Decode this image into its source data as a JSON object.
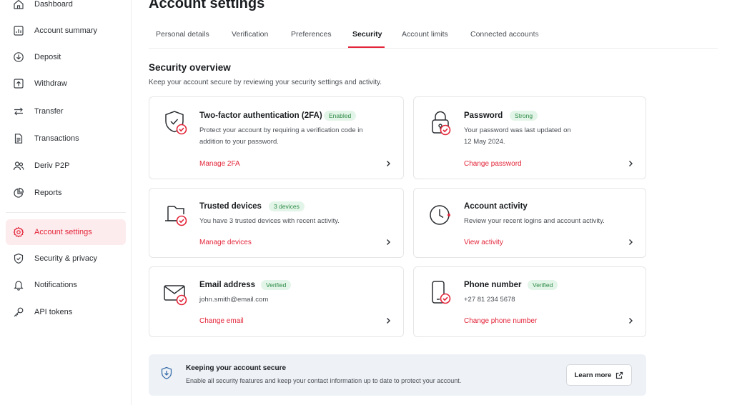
{
  "sidebar": {
    "items": [
      {
        "label": "Dashboard",
        "icon": "home-icon"
      },
      {
        "label": "Account summary",
        "icon": "chart-icon"
      },
      {
        "label": "Deposit",
        "icon": "deposit-icon"
      },
      {
        "label": "Withdraw",
        "icon": "withdraw-icon"
      },
      {
        "label": "Transfer",
        "icon": "transfer-icon"
      },
      {
        "label": "Transactions",
        "icon": "document-icon"
      },
      {
        "label": "Deriv P2P",
        "icon": "users-icon"
      },
      {
        "label": "Reports",
        "icon": "pie-chart-icon"
      },
      {
        "label": "Account settings",
        "icon": "gear-icon",
        "active": true
      },
      {
        "label": "Security & privacy",
        "icon": "shield-icon"
      },
      {
        "label": "Notifications",
        "icon": "bell-icon"
      },
      {
        "label": "API tokens",
        "icon": "key-icon"
      }
    ]
  },
  "header": {
    "title": "Account settings",
    "tabs": [
      {
        "label": "Personal details"
      },
      {
        "label": "Verification"
      },
      {
        "label": "Preferences"
      },
      {
        "label": "Security",
        "active": true
      },
      {
        "label": "Account limits"
      },
      {
        "label": "Connected accounts"
      }
    ]
  },
  "section": {
    "title": "Security overview",
    "subtitle": "Keep your account secure by reviewing your security settings and activity."
  },
  "cards": {
    "twofa": {
      "title": "Two-factor authentication (2FA)",
      "badge": "Enabled",
      "desc": "Protect your account by requiring a verification code in addition to your password.",
      "link": "Manage 2FA",
      "icon": "shield-check-icon"
    },
    "password": {
      "title": "Password",
      "badge": "Strong",
      "desc_line1": "Your password was last updated on",
      "desc_line2": "12 May 2024.",
      "link": "Change password",
      "icon": "padlock-icon"
    },
    "devices": {
      "title": "Trusted devices",
      "badge": "3 devices",
      "desc": "You have 3 trusted devices with recent activity.",
      "link": "Manage devices",
      "icon": "devices-icon"
    },
    "activity": {
      "title": "Account activity",
      "desc": "Review your recent logins and account activity.",
      "link": "View activity",
      "icon": "clock-icon"
    },
    "email": {
      "title": "Email address",
      "badge": "Verified",
      "value": "john.smith@email.com",
      "link": "Change email",
      "icon": "envelope-icon"
    },
    "phone": {
      "title": "Phone number",
      "badge": "Verified",
      "value": "+27 81 234 5678",
      "link": "Change phone number",
      "icon": "phone-icon"
    }
  },
  "banner": {
    "title": "Keeping your account secure",
    "desc": "Enable all security features and keep your contact information up to date to protect your account.",
    "button": "Learn more"
  },
  "colors": {
    "accent": "#e3263a",
    "badge_bg": "#e3f5e8",
    "badge_text": "#2e8b47",
    "active_nav_bg": "#fdecee",
    "banner_bg": "#eef2f7"
  }
}
